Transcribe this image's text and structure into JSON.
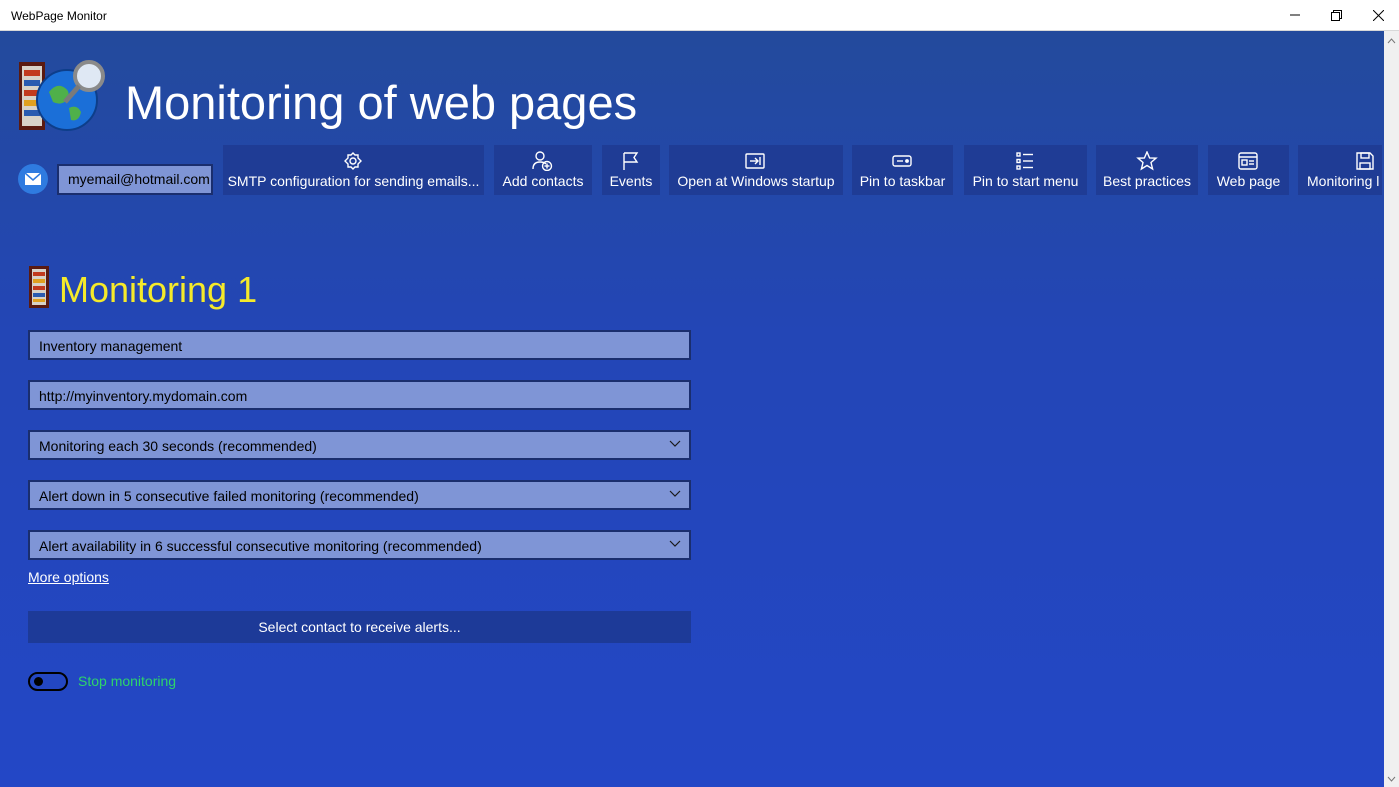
{
  "window": {
    "title": "WebPage Monitor"
  },
  "header": {
    "title": "Monitoring of web pages"
  },
  "toolbar": {
    "email_value": "myemail@hotmail.com",
    "buttons": [
      {
        "label": "SMTP configuration for sending emails...",
        "icon": "gear-icon"
      },
      {
        "label": "Add contacts",
        "icon": "add-contact-icon"
      },
      {
        "label": "Events",
        "icon": "flag-icon"
      },
      {
        "label": "Open at Windows startup",
        "icon": "startup-icon"
      },
      {
        "label": "Pin to taskbar",
        "icon": "taskbar-icon"
      },
      {
        "label": "Pin to start menu",
        "icon": "list-icon"
      },
      {
        "label": "Best practices",
        "icon": "star-icon"
      },
      {
        "label": "Web page",
        "icon": "web-page-icon"
      },
      {
        "label": "Monitoring l",
        "icon": "save-icon"
      }
    ]
  },
  "monitor": {
    "title": "Monitoring 1",
    "name_value": "Inventory management",
    "url_value": "http://myinventory.mydomain.com",
    "interval_selected": "Monitoring each 30 seconds (recommended)",
    "alert_down_selected": "Alert down in 5 consecutive failed monitoring (recommended)",
    "alert_up_selected": "Alert availability in 6 successful consecutive monitoring (recommended)",
    "more_options": "More options",
    "select_contact": "Select contact to receive alerts...",
    "toggle_label": "Stop monitoring",
    "toggle_on": false
  },
  "colors": {
    "background": "#2347b8",
    "section_title": "#f5ea2a",
    "toggle_label": "#2ed46a",
    "field_bg": "#7f95d6"
  }
}
